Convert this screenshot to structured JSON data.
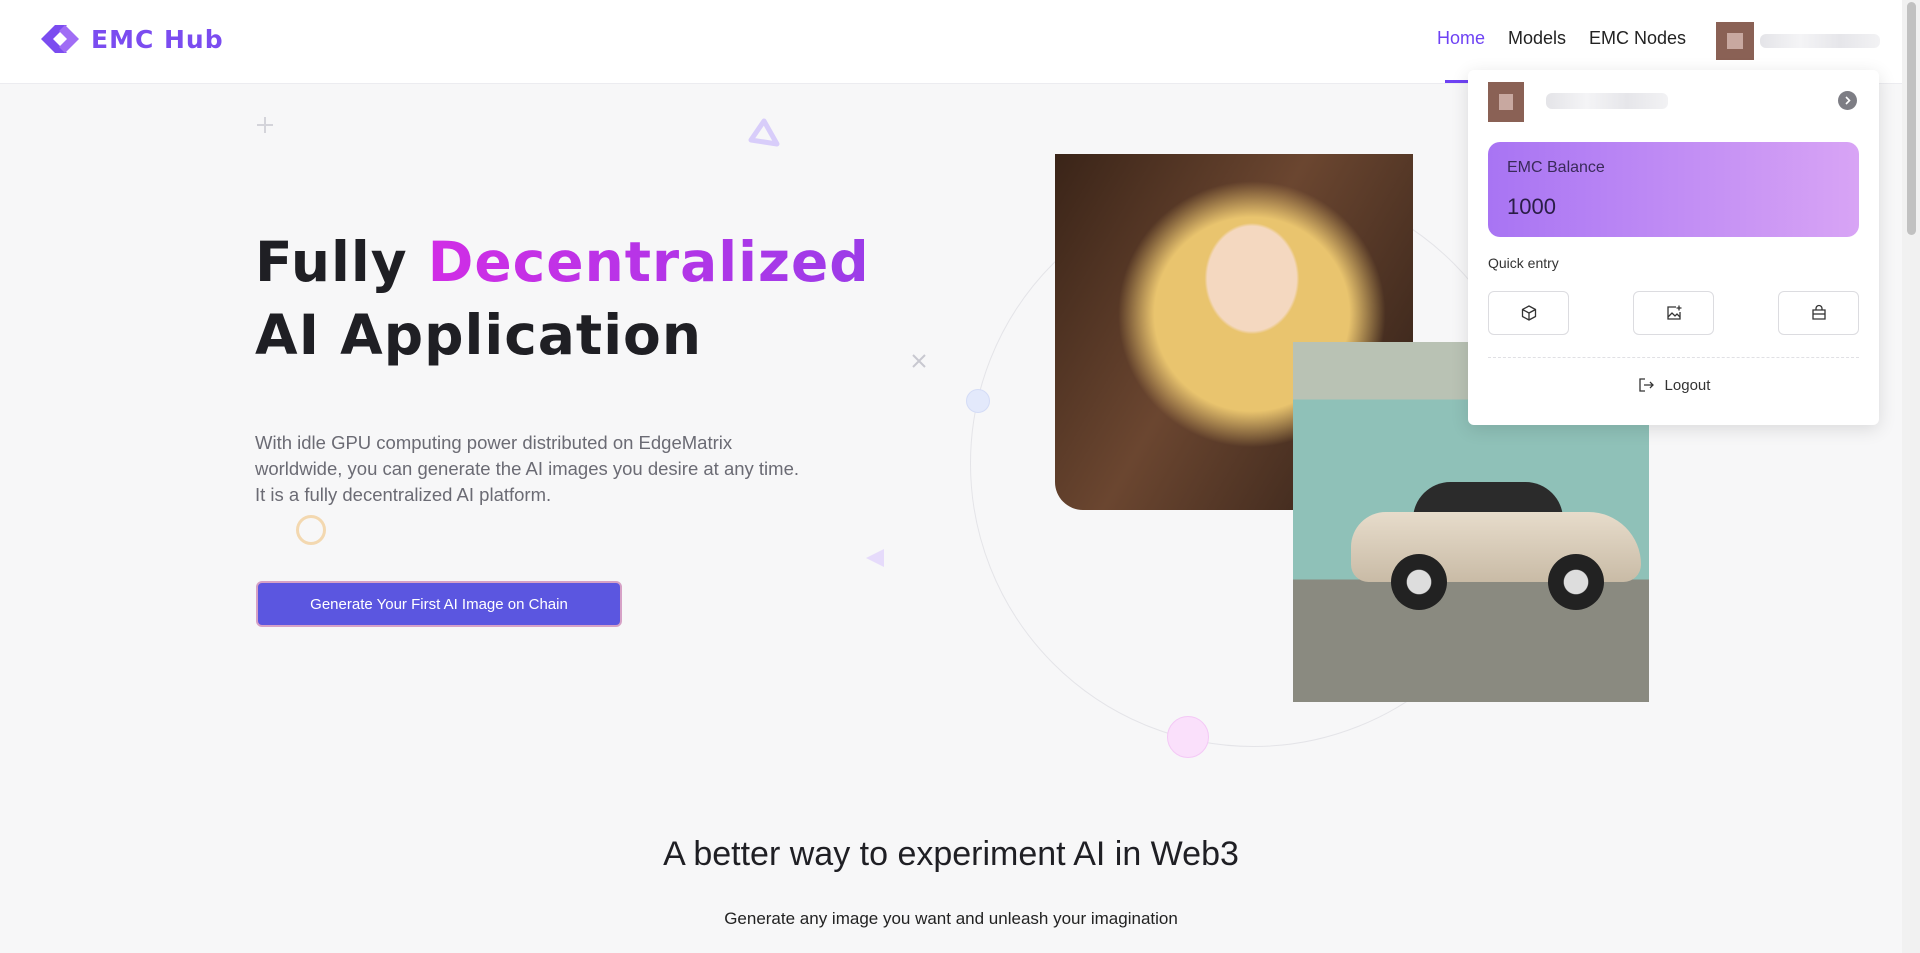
{
  "header": {
    "logo_text": "EMC Hub",
    "nav": [
      {
        "label": "Home",
        "active": true
      },
      {
        "label": "Models",
        "active": false
      },
      {
        "label": "EMC Nodes",
        "active": false
      }
    ],
    "accent_color": "#6e42f4"
  },
  "hero": {
    "title_line1_plain": "Fully ",
    "title_line1_accent": "Decentralized",
    "title_line2": "AI Application",
    "description": "With idle GPU computing power distributed on EdgeMatrix worldwide, you can generate the AI images you desire at any time. It is a fully decentralized AI platform.",
    "cta_label": "Generate Your First AI Image on Chain"
  },
  "user_menu": {
    "balance_label": "EMC Balance",
    "balance_value": "1000",
    "quick_entry_label": "Quick entry",
    "quick_entries": [
      {
        "icon": "cube-icon"
      },
      {
        "icon": "image-add-icon"
      },
      {
        "icon": "shopping-bag-icon"
      }
    ],
    "logout_label": "Logout"
  },
  "section": {
    "title": "A better way to experiment AI in Web3",
    "subtitle": "Generate any image you want and unleash your imagination"
  }
}
